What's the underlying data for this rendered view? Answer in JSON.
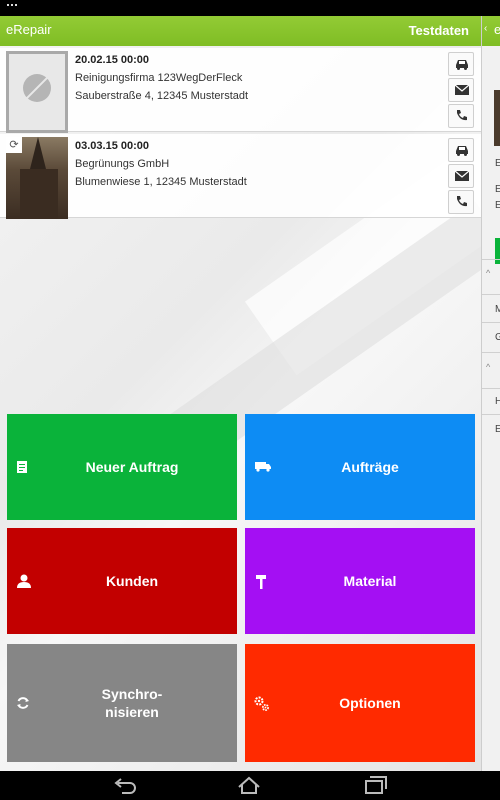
{
  "app": {
    "title": "eRepair",
    "action": "Testdaten"
  },
  "list": [
    {
      "date": "20.02.15 00:00",
      "name": "Reinigungsfirma 123WegDerFleck",
      "address": "Sauberstraße 4, 12345 Musterstadt",
      "thumb": "no-image"
    },
    {
      "date": "03.03.15 00:00",
      "name": "Begrünungs GmbH",
      "address": "Blumenwiese 1, 12345 Musterstadt",
      "thumb": "church-photo"
    }
  ],
  "tiles": {
    "new_order": {
      "label": "Neuer Auftrag",
      "icon": "document-icon",
      "color": "#0ab33a"
    },
    "orders": {
      "label": "Aufträge",
      "icon": "van-icon",
      "color": "#0d8cf4"
    },
    "customers": {
      "label": "Kunden",
      "icon": "person-icon",
      "color": "#c20000"
    },
    "material": {
      "label": "Material",
      "icon": "hammer-icon",
      "color": "#a40ff3"
    },
    "sync": {
      "label": "Synchro-\nnisieren",
      "icon": "sync-icon",
      "color": "#868686"
    },
    "options": {
      "label": "Optionen",
      "icon": "gears-icon",
      "color": "#ff2a00"
    }
  },
  "side_panel": {
    "title": "e",
    "chars": [
      "E",
      "E",
      "E",
      "M",
      "G",
      "H",
      "E"
    ]
  },
  "colors": {
    "appbar": "#86c22c",
    "background": "#eeeeee"
  }
}
